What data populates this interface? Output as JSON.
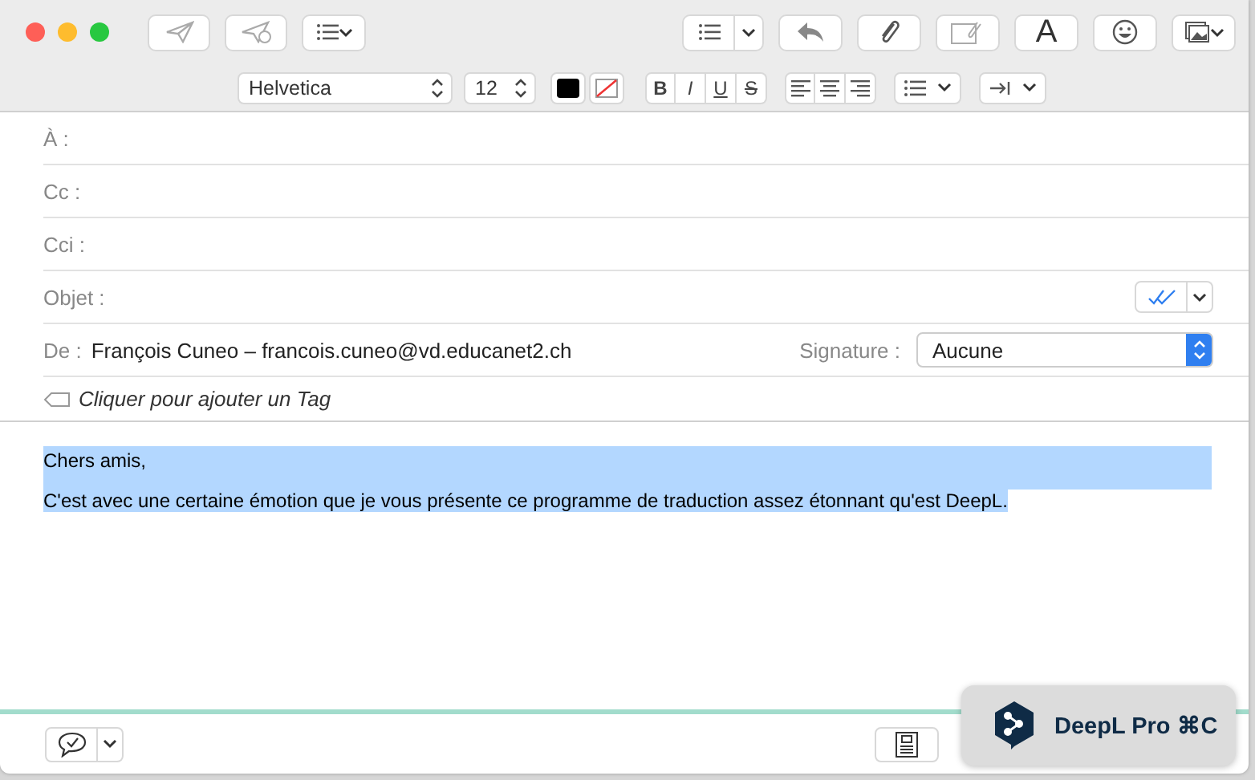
{
  "toolbar": {
    "text_button_label": "A"
  },
  "format_bar": {
    "font": "Helvetica",
    "size": "12",
    "styles": [
      {
        "label": "B",
        "kind": "bold"
      },
      {
        "label": "I",
        "kind": "italic"
      },
      {
        "label": "U",
        "kind": "underline"
      },
      {
        "label": "S",
        "kind": "strike"
      }
    ]
  },
  "header_fields": [
    {
      "label": "À :"
    },
    {
      "label": "Cc :"
    },
    {
      "label": "Cci :"
    },
    {
      "label": "Objet :"
    }
  ],
  "from": {
    "label": "De :",
    "value": "François Cuneo – francois.cuneo@vd.educanet2.ch",
    "signature_label": "Signature :",
    "signature_value": "Aucune"
  },
  "tag": {
    "placeholder": "Cliquer pour ajouter un Tag"
  },
  "body": [
    {
      "text": "Chers amis,",
      "selected": true
    },
    {
      "text": "C'est avec une certaine émotion que je vous présente ce programme de traduction assez étonnant qu'est DeepL.",
      "selected": true
    }
  ],
  "deepl_badge": {
    "label": "DeepL Pro ⌘C"
  }
}
